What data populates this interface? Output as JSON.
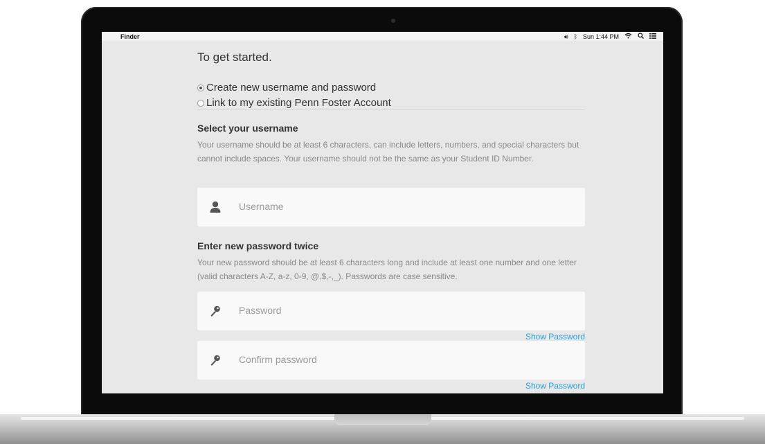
{
  "menubar": {
    "app_name": "Finder",
    "apple_icon": "apple-logo-icon",
    "clock": "Sun 1:44 PM",
    "volume_icon": "speaker-volume-icon",
    "bluetooth_icon": "bluetooth-icon",
    "wifi_icon": "wifi-icon",
    "search_icon": "spotlight-search-icon",
    "menu_icon": "notification-list-icon"
  },
  "page": {
    "heading": "To get started.",
    "options": [
      {
        "label": "Create new username and password",
        "checked": true
      },
      {
        "label": "Link to my existing Penn Foster Account",
        "checked": false
      }
    ],
    "username_section": {
      "title": "Select your username",
      "description": "Your username should be at least 6 characters, can include letters, numbers, and special characters but cannot include spaces. Your username should not be the same as your Student ID Number.",
      "placeholder": "Username",
      "icon": "user-icon"
    },
    "password_section": {
      "title": "Enter new password twice",
      "description": "Your new password should be at least 6 characters long and include at least one number and one letter (valid characters A-Z, a-z, 0-9, @,$,-,_). Passwords are case sensitive.",
      "password_placeholder": "Password",
      "confirm_placeholder": "Confirm password",
      "show_label": "Show Password",
      "icon": "key-icon"
    }
  },
  "colors": {
    "link": "#2a9fd8",
    "screen_bg": "#e8e8e8",
    "field_bg": "#f9f9f9"
  }
}
